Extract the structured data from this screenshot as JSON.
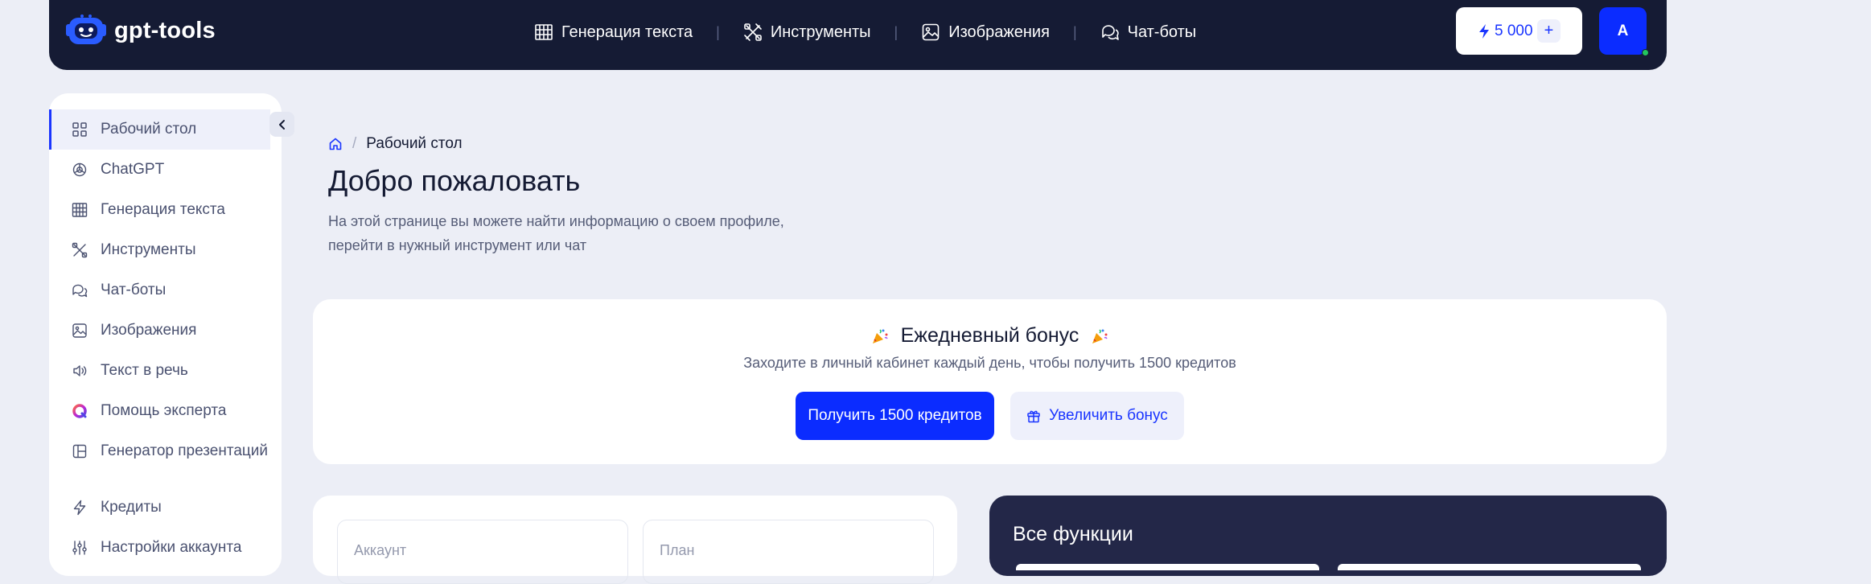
{
  "header": {
    "logo_text": "gpt-tools",
    "nav": [
      {
        "label": "Генерация текста",
        "icon": "text-grid-icon"
      },
      {
        "label": "Инструменты",
        "icon": "tools-icon"
      },
      {
        "label": "Изображения",
        "icon": "image-icon"
      },
      {
        "label": "Чат-боты",
        "icon": "chat-icon"
      }
    ],
    "credits_value": "5 000",
    "credits_plus": "+",
    "avatar_letter": "A"
  },
  "sidebar": {
    "items": [
      {
        "label": "Рабочий стол",
        "icon": "dashboard-icon",
        "active": true
      },
      {
        "label": "ChatGPT",
        "icon": "openai-icon"
      },
      {
        "label": "Генерация текста",
        "icon": "text-grid-icon"
      },
      {
        "label": "Инструменты",
        "icon": "tools-icon"
      },
      {
        "label": "Чат-боты",
        "icon": "chat-icon"
      },
      {
        "label": "Изображения",
        "icon": "image-icon"
      },
      {
        "label": "Текст в речь",
        "icon": "speaker-icon"
      },
      {
        "label": "Помощь эксперта",
        "icon": "expert-icon"
      },
      {
        "label": "Генератор презентаций",
        "icon": "presentation-icon"
      },
      {
        "label": "Кредиты",
        "icon": "bolt-icon"
      },
      {
        "label": "Настройки аккаунта",
        "icon": "settings-sliders-icon"
      }
    ]
  },
  "main": {
    "breadcrumb": "Рабочий стол",
    "breadcrumb_sep": "/",
    "title": "Добро пожаловать",
    "subtitle_line1": "На этой странице вы можете найти информацию о своем профиле,",
    "subtitle_line2": "перейти в нужный инструмент или чат"
  },
  "bonus": {
    "title": "Ежедневный бонус",
    "subtitle": "Заходите в личный кабинет каждый день, чтобы получить 1500 кредитов",
    "primary_button": "Получить 1500 кредитов",
    "secondary_button": "Увеличить бонус"
  },
  "profile": {
    "account_label": "Аккаунт",
    "plan_label": "План"
  },
  "features": {
    "title": "Все функции"
  },
  "colors": {
    "accent": "#0b2cff",
    "nav_bg": "#151b34",
    "page_bg": "#eceef6",
    "features_bg": "#232748",
    "online": "#23c55e"
  }
}
